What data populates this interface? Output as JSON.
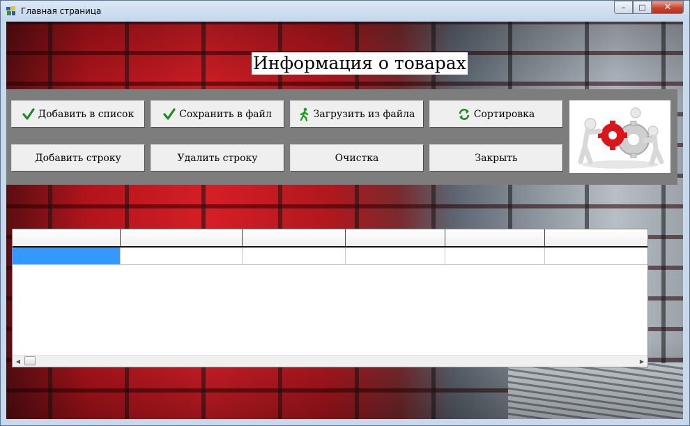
{
  "window": {
    "title": "Главная страница",
    "controls": {
      "minimize": "–",
      "maximize": "□",
      "close": "✕"
    }
  },
  "heading": "Информация о товарах",
  "toolbar": {
    "add_to_list": {
      "label": "Добавить в список",
      "icon": "check-icon"
    },
    "save_to_file": {
      "label": "Сохранить в файл",
      "icon": "check-icon"
    },
    "load_from_file": {
      "label": "Загрузить из файла",
      "icon": "running-man-icon"
    },
    "sort": {
      "label": "Сортировка",
      "icon": "refresh-icon"
    },
    "add_row": {
      "label": "Добавить строку"
    },
    "delete_row": {
      "label": "Удалить строку"
    },
    "clear": {
      "label": "Очистка"
    },
    "close": {
      "label": "Закрыть"
    }
  },
  "illustration": "teamwork-gears-image",
  "grid": {
    "column_headers": [
      "",
      "",
      "",
      "",
      "",
      ""
    ],
    "rows": [
      [
        "",
        "",
        "",
        "",
        "",
        ""
      ]
    ],
    "selected_cell": {
      "row": 0,
      "col": 0
    },
    "scroll": {
      "left": "◀",
      "right": "▶"
    }
  },
  "colors": {
    "panel": "#7d7d7d",
    "selection": "#3399ff",
    "button_face": "#efefef",
    "close_button": "#c7432e"
  }
}
